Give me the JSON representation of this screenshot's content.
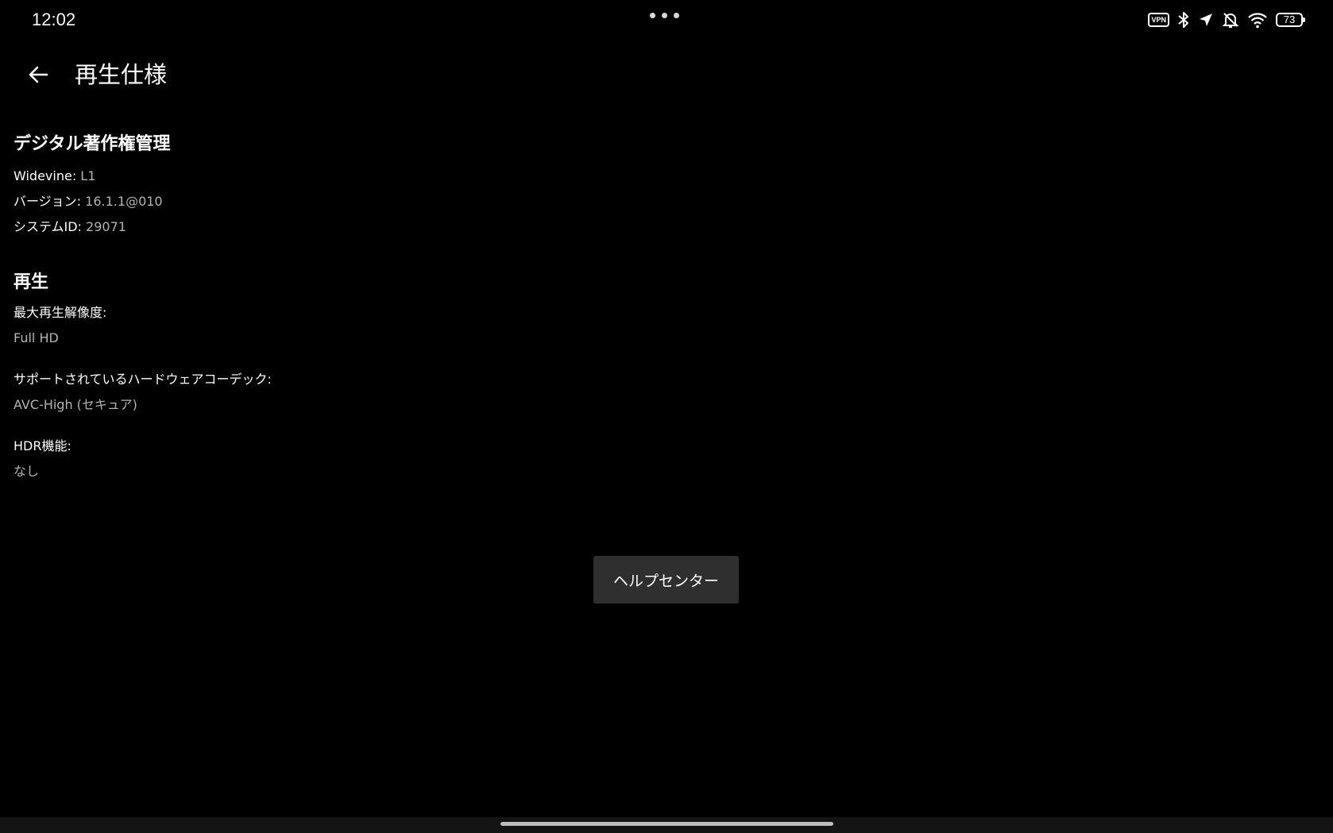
{
  "status_bar": {
    "time": "12:02",
    "vpn_label": "VPN",
    "battery_level": "73",
    "icons": [
      "vpn-icon",
      "bluetooth-icon",
      "location-arrow-icon",
      "bell-off-icon",
      "wifi-icon",
      "battery-icon"
    ]
  },
  "app_bar": {
    "title": "再生仕様",
    "back_icon": "arrow-left-icon"
  },
  "drm": {
    "title": "デジタル著作権管理",
    "items": [
      {
        "key": "Widevine:",
        "value": "L1"
      },
      {
        "key": "バージョン:",
        "value": "16.1.1@010"
      },
      {
        "key": "システムID:",
        "value": "29071"
      }
    ]
  },
  "playback": {
    "title": "再生",
    "items": [
      {
        "label": "最大再生解像度:",
        "value": "Full HD"
      },
      {
        "label": "サポートされているハードウェアコーデック:",
        "value": "AVC-High (セキュア)"
      },
      {
        "label": "HDR機能:",
        "value": "なし"
      }
    ]
  },
  "help_button": {
    "label": "ヘルプセンター"
  },
  "colors": {
    "background": "#000000",
    "primary_text": "#ffffff",
    "secondary_text": "#b3b3b3",
    "button_bg": "#2f2f2f"
  }
}
